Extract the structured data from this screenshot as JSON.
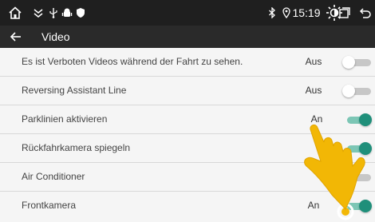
{
  "statusbar": {
    "home_icon": "home-icon",
    "notification_icons": [
      "navigation-icon",
      "usb-icon",
      "android-debug-icon",
      "shield-icon"
    ],
    "bluetooth_icon": "bluetooth-icon",
    "location_icon": "location-icon",
    "time": "15:19",
    "brightness_icon": "brightness-icon",
    "recents_icon": "recents-icon",
    "back_icon": "back-icon"
  },
  "appbar": {
    "back_icon": "arrow-left-icon",
    "title": "Video"
  },
  "settings": [
    {
      "label": "Es ist Verboten Videos während der Fahrt zu sehen.",
      "value": "Aus",
      "enabled": false
    },
    {
      "label": "Reversing Assistant Line",
      "value": "Aus",
      "enabled": false
    },
    {
      "label": "Parklinien aktivieren",
      "value": "An",
      "enabled": true
    },
    {
      "label": "Rückfahrkamera spiegeln",
      "value": "",
      "enabled": true
    },
    {
      "label": "Air Conditioner",
      "value": "",
      "enabled": false
    },
    {
      "label": "Frontkamera",
      "value": "An",
      "enabled": true
    }
  ],
  "overlay": {
    "icon": "tap-hand-icon",
    "color": "#f2b705"
  },
  "colors": {
    "accent": "#1f8f7a",
    "accent_track": "#7cc6b5",
    "statusbar_bg": "#1f1f1f",
    "appbar_bg": "#2a2a2a"
  }
}
